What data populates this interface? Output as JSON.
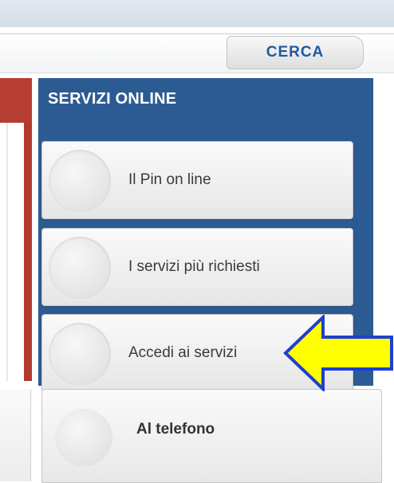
{
  "search": {
    "placeholder": "",
    "button_label": "CERCA"
  },
  "services_panel": {
    "title": "SERVIZI ONLINE",
    "items": [
      {
        "label": "Il Pin on line"
      },
      {
        "label": "I servizi più richiesti"
      },
      {
        "label": "Accedi ai servizi"
      }
    ]
  },
  "phone": {
    "label": "Al telefono"
  },
  "colors": {
    "panel_blue": "#2c5b93",
    "accent_red": "#b53d32",
    "cerca_text": "#1f5a9e",
    "arrow_fill": "#ffff00",
    "arrow_stroke": "#1e3fd0"
  },
  "annotation": {
    "icon": "arrow-left-icon"
  }
}
